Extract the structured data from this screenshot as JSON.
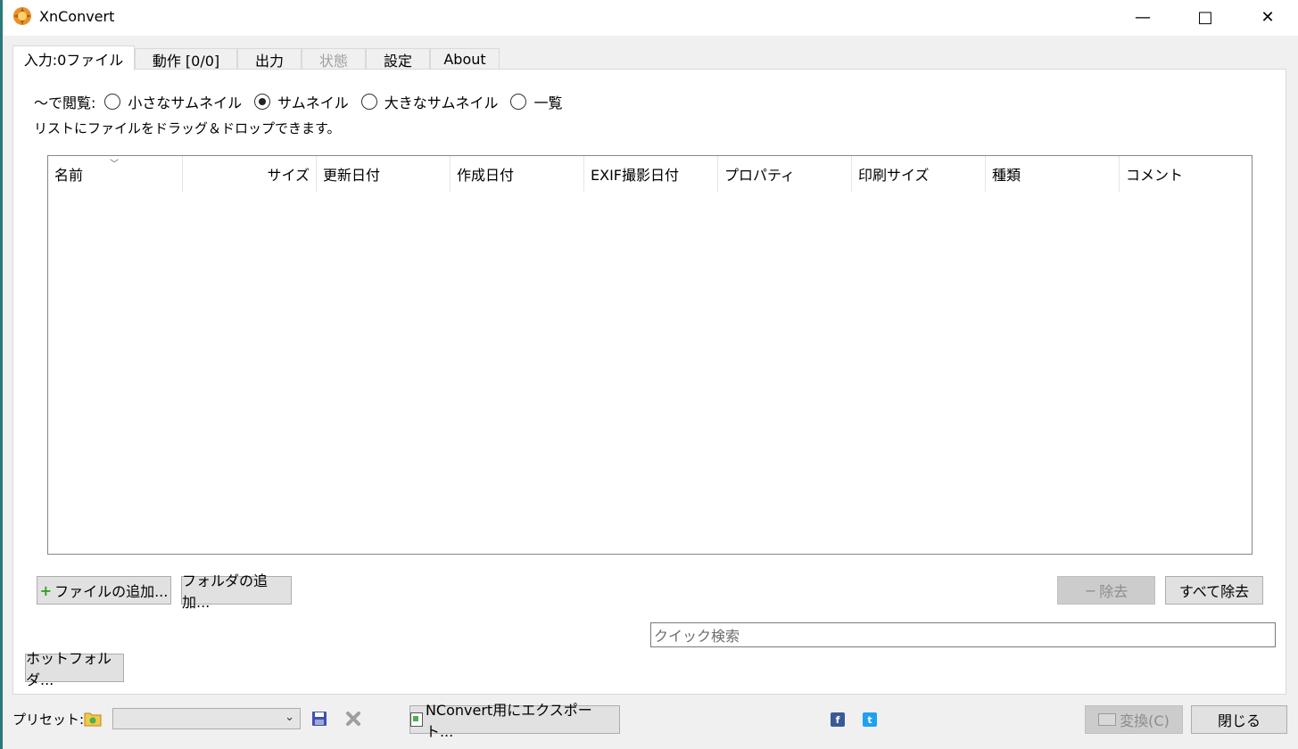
{
  "window": {
    "title": "XnConvert",
    "minimize_glyph": "—",
    "maximize_glyph": "□",
    "close_glyph": "✕"
  },
  "tabs": [
    {
      "label": "入力:0ファイル",
      "active": true
    },
    {
      "label": "動作 [0/0]"
    },
    {
      "label": "出力"
    },
    {
      "label": "状態",
      "disabled": true
    },
    {
      "label": "設定"
    },
    {
      "label": "About"
    }
  ],
  "view": {
    "label": "〜で閲覧:",
    "options": [
      "小さなサムネイル",
      "サムネイル",
      "大きなサムネイル",
      "一覧"
    ],
    "selected": "サムネイル"
  },
  "hint": "リストにファイルをドラッグ＆ドロップできます。",
  "file_list": {
    "sort_glyph": "﹀",
    "columns": [
      "名前",
      "サイズ",
      "更新日付",
      "作成日付",
      "EXIF撮影日付",
      "プロパティ",
      "印刷サイズ",
      "種類",
      "コメント"
    ],
    "rows": []
  },
  "buttons": {
    "add_files": "ファイルの追加...",
    "add_folder": "フォルダの追加...",
    "remove": "除去",
    "remove_glyph": "−",
    "remove_all": "すべて除去",
    "hot_folder": "ホットフォルダ...",
    "export": "NConvert用にエクスポート...",
    "convert": "変換(C)",
    "close": "閉じる"
  },
  "search": {
    "placeholder": "クイック検索",
    "value": ""
  },
  "preset": {
    "label": "プリセット:",
    "value": ""
  },
  "icons": {
    "add": "plus-icon",
    "preset_folder": "folder-icon",
    "save": "save-icon",
    "delete": "delete-icon",
    "facebook": "facebook-icon",
    "twitter": "twitter-icon"
  },
  "colors": {
    "accent_facebook": "#3b5998",
    "accent_twitter": "#1da1f2",
    "disabled_button": "#cccccc"
  }
}
